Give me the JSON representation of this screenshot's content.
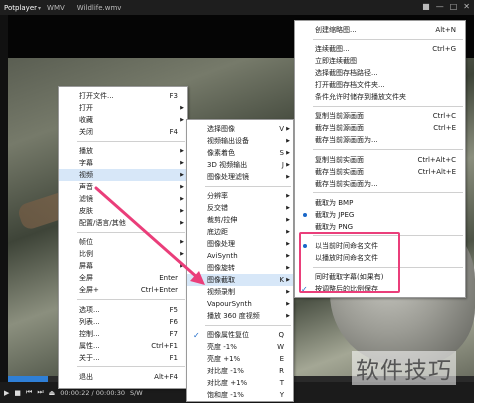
{
  "titlebar": {
    "app": "Potplayer",
    "tab1": "WMV",
    "tab2": "Wildlife.wmv",
    "win_buttons": [
      "■",
      "—",
      "□",
      "✕"
    ]
  },
  "controls": {
    "time": "00:00:22 / 00:00:30",
    "format": "S/W"
  },
  "menu1": {
    "items": [
      {
        "label": "打开文件...",
        "shortcut": "F3"
      },
      {
        "label": "打开",
        "arrow": "▶"
      },
      {
        "label": "收藏",
        "arrow": "▶"
      },
      {
        "label": "关闭",
        "shortcut": "F4"
      },
      {
        "label": "播放",
        "arrow": "▶"
      },
      {
        "label": "字幕",
        "arrow": "▶"
      },
      {
        "label": "视频",
        "arrow": "▶"
      },
      {
        "label": "声音",
        "arrow": "▶"
      },
      {
        "label": "滤镜",
        "arrow": "▶"
      },
      {
        "label": "皮肤",
        "arrow": "▶"
      },
      {
        "label": "配置/语言/其他",
        "arrow": "▶"
      },
      {
        "label": "帧位",
        "arrow": "▶"
      },
      {
        "label": "比例",
        "arrow": "▶"
      },
      {
        "label": "屏幕",
        "arrow": "▶"
      },
      {
        "label": "全屏",
        "shortcut": "Enter"
      },
      {
        "label": "全屏+",
        "shortcut": "Ctrl+Enter"
      },
      {
        "label": "选项...",
        "shortcut": "F5"
      },
      {
        "label": "列表...",
        "shortcut": "F6"
      },
      {
        "label": "控制...",
        "shortcut": "F7"
      },
      {
        "label": "属性...",
        "shortcut": "Ctrl+F1"
      },
      {
        "label": "关于...",
        "shortcut": "F1"
      },
      {
        "label": "退出",
        "shortcut": "Alt+F4"
      }
    ]
  },
  "menu2": {
    "items": [
      {
        "label": "选择图像",
        "shortcut": "V",
        "arrow": "▶"
      },
      {
        "label": "视频输出设备",
        "arrow": "▶"
      },
      {
        "label": "像素着色",
        "shortcut": "S",
        "arrow": "▶"
      },
      {
        "label": "3D 视频输出",
        "shortcut": "J",
        "arrow": "▶"
      },
      {
        "label": "图像处理滤镜",
        "arrow": "▶"
      },
      {
        "label": "分辨率",
        "arrow": "▶"
      },
      {
        "label": "反交错",
        "arrow": "▶"
      },
      {
        "label": "裁剪/拉伸",
        "arrow": "▶"
      },
      {
        "label": "底边距",
        "arrow": "▶"
      },
      {
        "label": "图像处理",
        "arrow": "▶"
      },
      {
        "label": "AviSynth",
        "arrow": "▶"
      },
      {
        "label": "图像旋转",
        "arrow": "▶"
      },
      {
        "label": "图像截取",
        "shortcut": "K",
        "arrow": "▶"
      },
      {
        "label": "视频录制",
        "arrow": "▶"
      },
      {
        "label": "VapourSynth",
        "arrow": "▶"
      },
      {
        "label": "播放 360 度视频",
        "arrow": "▶"
      },
      {
        "label": "图像属性复位",
        "shortcut": "Q",
        "check": "✓"
      },
      {
        "label": "亮度 -1%",
        "shortcut": "W"
      },
      {
        "label": "亮度 +1%",
        "shortcut": "E"
      },
      {
        "label": "对比度 -1%",
        "shortcut": "R"
      },
      {
        "label": "对比度 +1%",
        "shortcut": "T"
      },
      {
        "label": "饱和度 -1%",
        "shortcut": "Y"
      }
    ]
  },
  "menu3": {
    "items": [
      {
        "label": "创建缩略图...",
        "shortcut": "Alt+N"
      },
      {
        "label": "连续截图...",
        "shortcut": "Ctrl+G"
      },
      {
        "label": "立即连续截图"
      },
      {
        "label": "选择截图存档路径..."
      },
      {
        "label": "打开截图存档文件夹..."
      },
      {
        "label": "条件允许时储存到播放文件夹"
      },
      {
        "label": "复制当前源画面",
        "shortcut": "Ctrl+C"
      },
      {
        "label": "截存当前源画面",
        "shortcut": "Ctrl+E"
      },
      {
        "label": "截存当前源画面为..."
      },
      {
        "label": "复制当前实画面",
        "shortcut": "Ctrl+Alt+C"
      },
      {
        "label": "截存当前实画面",
        "shortcut": "Ctrl+Alt+E"
      },
      {
        "label": "截存当前实画面为..."
      },
      {
        "label": "截取为 BMP"
      },
      {
        "label": "截取为 JPEG"
      },
      {
        "label": "截取为 PNG"
      },
      {
        "label": "以当前时间命名文件"
      },
      {
        "label": "以播放时间命名文件"
      },
      {
        "label": "同时截取字幕(如果有)"
      },
      {
        "label": "按调整后的比例保存"
      }
    ]
  },
  "watermark": "软件技巧",
  "colors": {
    "highlight": "#ea3e7a",
    "accent": "#2f7fd6"
  }
}
